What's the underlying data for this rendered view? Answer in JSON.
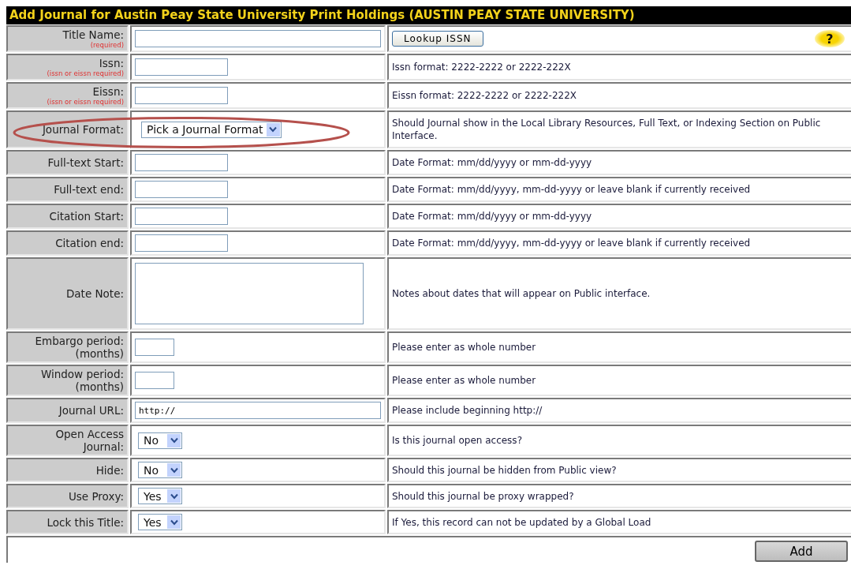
{
  "header": {
    "title": "Add Journal for Austin Peay State University Print Holdings (AUSTIN PEAY STATE UNIVERSITY)"
  },
  "rows": [
    {
      "label": "Title Name:",
      "note": "(required)",
      "field": {
        "kind": "wide_input"
      },
      "button": "Lookup ISSN",
      "help_icon": "?"
    },
    {
      "label": "Issn:",
      "note": "(issn or eissn required)",
      "field": {
        "kind": "short_input"
      },
      "hint": "Issn format: 2222-2222 or 2222-222X"
    },
    {
      "label": "Eissn:",
      "note": "(issn or eissn required)",
      "field": {
        "kind": "short_input"
      },
      "hint": "Eissn format: 2222-2222 or 2222-222X"
    },
    {
      "label": "Journal Format:",
      "field": {
        "kind": "select",
        "value": "Pick a Journal Format"
      },
      "hint": "Should Journal show in the Local Library Resources, Full Text, or Indexing Section on Public Interface.",
      "circled": true
    },
    {
      "label": "Full-text Start:",
      "field": {
        "kind": "short_input"
      },
      "hint": "Date Format: mm/dd/yyyy or mm-dd-yyyy"
    },
    {
      "label": "Full-text end:",
      "field": {
        "kind": "short_input"
      },
      "hint": "Date Format: mm/dd/yyyy, mm-dd-yyyy or leave blank if currently received"
    },
    {
      "label": "Citation Start:",
      "field": {
        "kind": "short_input"
      },
      "hint": "Date Format: mm/dd/yyyy or mm-dd-yyyy"
    },
    {
      "label": "Citation end:",
      "field": {
        "kind": "short_input"
      },
      "hint": "Date Format: mm/dd/yyyy, mm-dd-yyyy or leave blank if currently received"
    },
    {
      "label": "Date Note:",
      "field": {
        "kind": "textarea"
      },
      "hint": "Notes about dates that will appear on Public interface."
    },
    {
      "label": "Embargo period: (months)",
      "field": {
        "kind": "tiny_input"
      },
      "hint": "Please enter as whole number"
    },
    {
      "label": "Window period: (months)",
      "field": {
        "kind": "tiny_input"
      },
      "hint": "Please enter as whole number"
    },
    {
      "label": "Journal URL:",
      "field": {
        "kind": "wide_input",
        "value": "http://"
      },
      "hint": "Please include beginning http://"
    },
    {
      "label": "Open Access Journal:",
      "field": {
        "kind": "select",
        "value": "No"
      },
      "hint": "Is this journal open access?"
    },
    {
      "label": "Hide:",
      "field": {
        "kind": "select",
        "value": "No"
      },
      "hint": "Should this journal be hidden from Public view?"
    },
    {
      "label": "Use Proxy:",
      "field": {
        "kind": "select",
        "value": "Yes"
      },
      "hint": "Should this journal be proxy wrapped?"
    },
    {
      "label": "Lock this Title:",
      "field": {
        "kind": "select",
        "value": "Yes"
      },
      "hint": "If Yes, this record can not be updated by a Global Load"
    }
  ],
  "submit": "Add"
}
